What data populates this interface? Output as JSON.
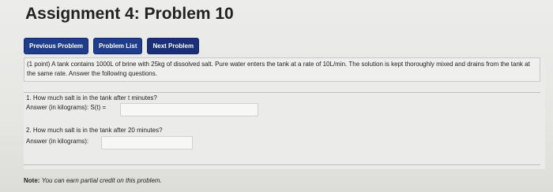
{
  "page": {
    "title": "Assignment 4: Problem 10"
  },
  "nav": {
    "previous_label": "Previous Problem",
    "list_label": "Problem List",
    "next_label": "Next Problem"
  },
  "problem": {
    "statement": "(1 point) A tank contains 1000L of brine with 25kg of dissolved salt. Pure water enters the tank at a rate of 10L/min. The solution is kept thoroughly mixed and drains from the tank at the same rate. Answer the following questions.",
    "q1": {
      "text": "1. How much salt is in the tank after t minutes?",
      "answer_label": "Answer (in kilograms): S(t) =",
      "answer_value": ""
    },
    "q2": {
      "text": "2. How much salt is in the tank after 20 minutes?",
      "answer_label": "Answer (in kilograms):",
      "answer_value": ""
    }
  },
  "note": {
    "prefix": "Note:",
    "text": "You can earn partial credit on this problem."
  },
  "colors": {
    "nav_button": "#1f3d8a",
    "background": "#e8e8e6"
  }
}
